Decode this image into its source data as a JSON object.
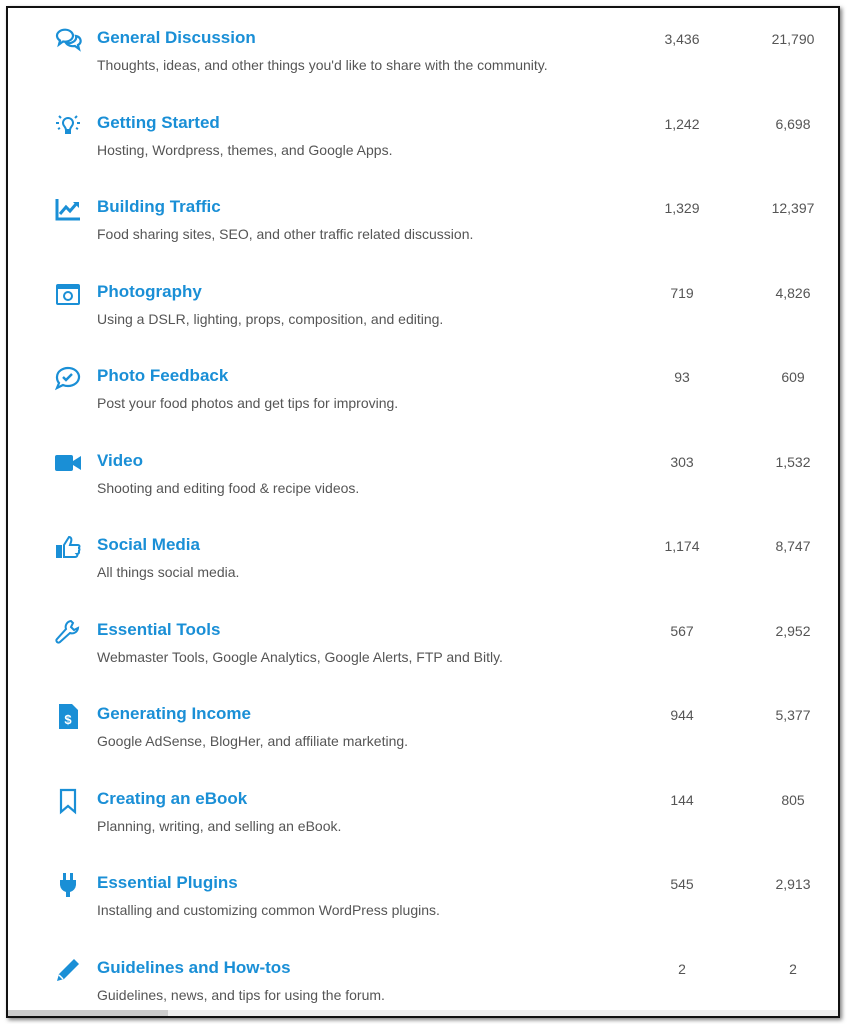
{
  "accent_color": "#1a8fd6",
  "categories": [
    {
      "icon": "chat-bubbles-icon",
      "title": "General Discussion",
      "description": "Thoughts, ideas, and other things you'd like to share with the community.",
      "topics": "3,436",
      "posts": "21,790"
    },
    {
      "icon": "lightbulb-icon",
      "title": "Getting Started",
      "description": "Hosting, Wordpress, themes, and Google Apps.",
      "topics": "1,242",
      "posts": "6,698"
    },
    {
      "icon": "trend-chart-icon",
      "title": "Building Traffic",
      "description": "Food sharing sites, SEO, and other traffic related discussion.",
      "topics": "1,329",
      "posts": "12,397"
    },
    {
      "icon": "camera-icon",
      "title": "Photography",
      "description": "Using a DSLR, lighting, props, composition, and editing.",
      "topics": "719",
      "posts": "4,826"
    },
    {
      "icon": "check-bubble-icon",
      "title": "Photo Feedback",
      "description": "Post your food photos and get tips for improving.",
      "topics": "93",
      "posts": "609"
    },
    {
      "icon": "video-camera-icon",
      "title": "Video",
      "description": "Shooting and editing food & recipe videos.",
      "topics": "303",
      "posts": "1,532"
    },
    {
      "icon": "thumbs-up-icon",
      "title": "Social Media",
      "description": "All things social media.",
      "topics": "1,174",
      "posts": "8,747"
    },
    {
      "icon": "wrench-icon",
      "title": "Essential Tools",
      "description": "Webmaster Tools, Google Analytics, Google Alerts, FTP and Bitly.",
      "topics": "567",
      "posts": "2,952"
    },
    {
      "icon": "dollar-document-icon",
      "title": "Generating Income",
      "description": "Google AdSense, BlogHer, and affiliate marketing.",
      "topics": "944",
      "posts": "5,377"
    },
    {
      "icon": "bookmark-icon",
      "title": "Creating an eBook",
      "description": "Planning, writing, and selling an eBook.",
      "topics": "144",
      "posts": "805"
    },
    {
      "icon": "plug-icon",
      "title": "Essential Plugins",
      "description": "Installing and customizing common WordPress plugins.",
      "topics": "545",
      "posts": "2,913"
    },
    {
      "icon": "pencil-icon",
      "title": "Guidelines and How-tos",
      "description": "Guidelines, news, and tips for using the forum.",
      "topics": "2",
      "posts": "2"
    }
  ]
}
